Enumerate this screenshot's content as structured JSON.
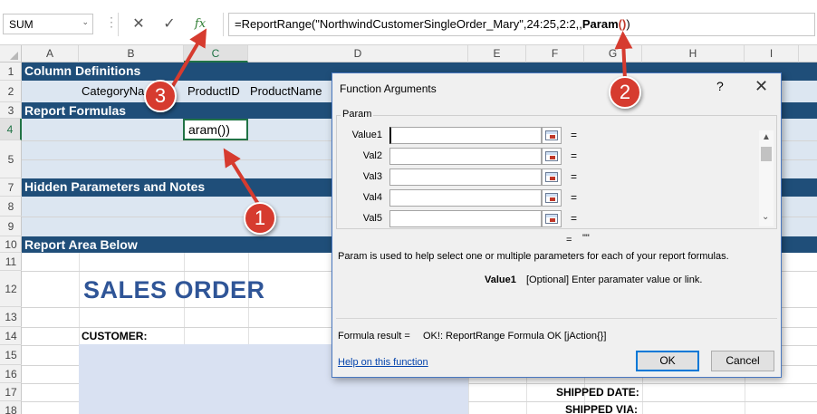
{
  "formula_bar": {
    "name_box": "SUM",
    "dropdown_glyph": "⌄",
    "dots": "⋮",
    "cancel_glyph": "✕",
    "enter_glyph": "✓",
    "fx_label": "fx",
    "formula_prefix": "=ReportRange(\"NorthwindCustomerSingleOrder_Mary\",24:25,2:2,,",
    "formula_func": "Param",
    "formula_parens": "()",
    "formula_suffix": ")"
  },
  "columns": [
    "A",
    "B",
    "C",
    "D",
    "E",
    "F",
    "G",
    "H",
    "I"
  ],
  "rows": [
    "1",
    "2",
    "3",
    "4",
    "5",
    "7",
    "8",
    "9",
    "10",
    "11",
    "12",
    "13",
    "14",
    "15",
    "16",
    "17",
    "18"
  ],
  "sheet": {
    "band_column_definitions": "Column Definitions",
    "col_def_category": "CategoryNa",
    "col_def_productid": "ProductID",
    "col_def_productname": "ProductName",
    "band_report_formulas": "Report Formulas",
    "active_cell_value": "aram())",
    "band_hidden_params": "Hidden Parameters and Notes",
    "band_report_area": "Report Area Below",
    "sales_order_title": "SALES ORDER",
    "customer_label": "CUSTOMER:",
    "shipped_date_label": "SHIPPED DATE:",
    "shipped_via_label": "SHIPPED VIA:"
  },
  "dialog": {
    "title": "Function Arguments",
    "help_glyph": "?",
    "close_glyph": "✕",
    "group_label": "Param",
    "args": [
      {
        "label": "Value1",
        "value": "",
        "eq": "="
      },
      {
        "label": "Val2",
        "value": "",
        "eq": "="
      },
      {
        "label": "Val3",
        "value": "",
        "eq": "="
      },
      {
        "label": "Val4",
        "value": "",
        "eq": "="
      },
      {
        "label": "Val5",
        "value": "",
        "eq": "="
      }
    ],
    "scroll_up": "▲",
    "scroll_down": "⌄",
    "result_eq": "=",
    "result_value": "\"\"",
    "description": "Param is used to help select one or multiple parameters for each of your report formulas.",
    "param_name": "Value1",
    "param_description": "[Optional] Enter paramater value or link.",
    "formula_result_label": "Formula result =",
    "formula_result_value": "OK!: ReportRange Formula OK [jAction{}]",
    "help_link": "Help on this function",
    "ok_label": "OK",
    "cancel_label": "Cancel"
  },
  "callouts": [
    "1",
    "2",
    "3"
  ],
  "colors": {
    "band": "#1f4e79",
    "band_light": "#dce6f1",
    "excel_green": "#217346",
    "title_blue": "#2f5597",
    "callout_red": "#d63b2f"
  }
}
